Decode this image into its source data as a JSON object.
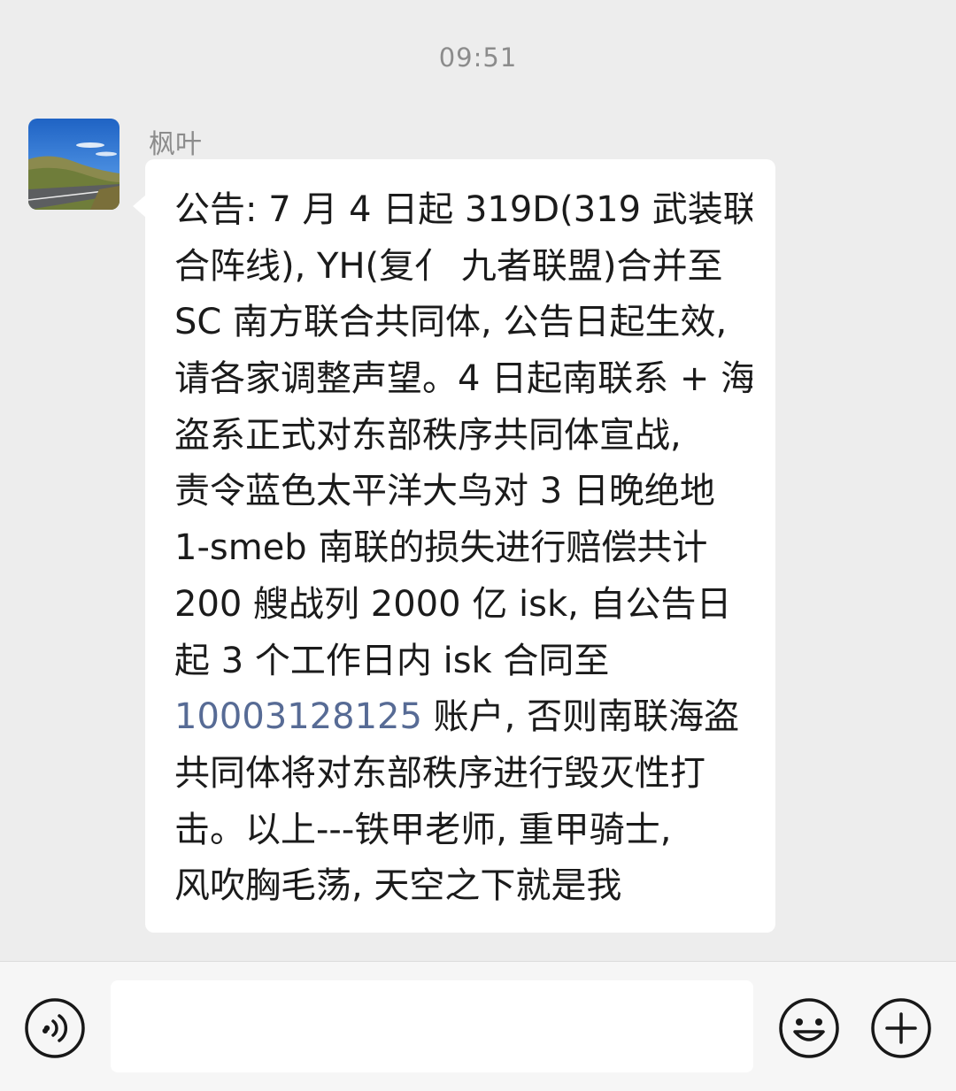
{
  "chat": {
    "timestamp": "09:51",
    "message": {
      "sender": "枫叶",
      "avatar": "landscape-road-photo",
      "lines": [
        "公告: 7 月 4 日起 319D(319 武装联",
        "合阵线), YH(复亻 九者联盟)合并至",
        "SC 南方联合共同体, 公告日起生效,",
        "请各家调整声望。4 日起南联系 + 海",
        "盗系正式对东部秩序共同体宣战,",
        "责令蓝色太平洋大鸟对 3 日晚绝地",
        "1-smeb 南联的损失进行赔偿共计",
        "200 艘战列 2000 亿 isk, 自公告日",
        "起 3 个工作日内 isk 合同至",
        "账户, 否则南联海盗",
        "共同体将对东部秩序进行毁灭性打",
        "击。以上---铁甲老师, 重甲骑士,",
        "风吹胸毛荡, 天空之下就是我"
      ],
      "link_number": "10003128125"
    }
  },
  "input_bar": {
    "text_value": "",
    "voice_icon": "voice-icon",
    "emoji_icon": "emoji-icon",
    "more_icon": "plus-icon"
  },
  "colors": {
    "background": "#ededed",
    "bubble": "#ffffff",
    "text": "#1b1b1b",
    "meta_text": "#8c8c8c",
    "link": "#576b95",
    "input_bar": "#f6f6f6"
  }
}
